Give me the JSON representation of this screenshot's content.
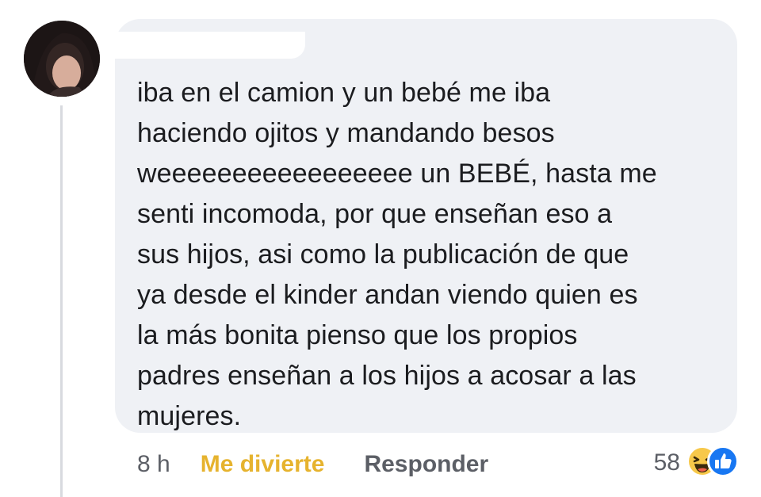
{
  "comment": {
    "lines": [
      "iba en el camion y un bebé me iba",
      "haciendo ojitos y mandando besos",
      "weeeeeeeeeeeeeeeee un BEBÉ, hasta me",
      "senti incomoda, por que enseñan eso a",
      "sus hijos, asi como la publicación de que",
      "ya desde el kinder andan viendo quien es",
      "la más bonita pienso que los propios",
      "padres enseñan a los hijos a acosar a las",
      "mujeres."
    ]
  },
  "actions": {
    "time": "8 h",
    "reaction": "Me divierte",
    "reply": "Responder"
  },
  "reactions": {
    "count": "58",
    "icons": [
      "haha-icon",
      "like-icon"
    ]
  },
  "colors": {
    "bubble": "#eff1f5",
    "reaction_accent": "#e6b32e",
    "like_blue": "#1877f2",
    "meta_gray": "#5c5f66"
  }
}
